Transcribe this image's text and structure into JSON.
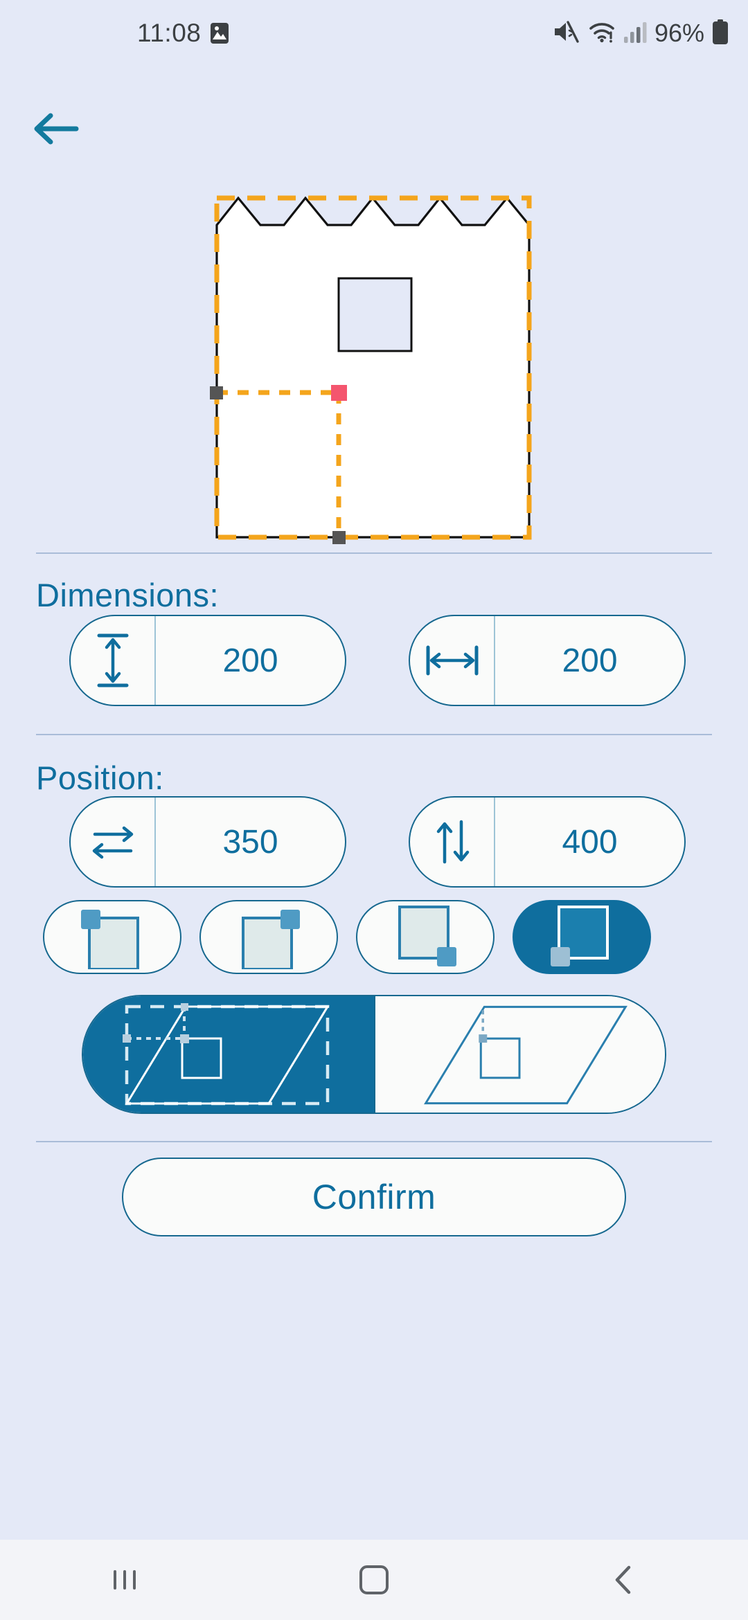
{
  "status_bar": {
    "time": "11:08",
    "battery_percent": "96%",
    "icons": [
      "gallery-image-icon",
      "mute-icon",
      "wifi-warning-icon",
      "signal-bars-icon",
      "battery-icon"
    ]
  },
  "header": {
    "back_label": "Back"
  },
  "preview": {
    "shape_name": "sawtooth-polygon",
    "bounding_box_color": "#f4a51c",
    "shape_stroke_color": "#111111",
    "shape_fill_color": "#ffffff",
    "inner_rect_fill": "#e4e9f7",
    "anchor_marker_color": "#f4556e",
    "handle_color": "#555555",
    "guide_color": "#f4a51c"
  },
  "dimensions": {
    "title": "Dimensions:",
    "height_field": {
      "icon": "height-arrow-icon",
      "value": "200"
    },
    "width_field": {
      "icon": "width-arrow-icon",
      "value": "200"
    }
  },
  "position": {
    "title": "Position:",
    "x_field": {
      "icon": "horizontal-arrows-icon",
      "value": "350"
    },
    "y_field": {
      "icon": "vertical-arrows-icon",
      "value": "400"
    },
    "anchor_options": [
      {
        "name": "anchor-top-left",
        "selected": false
      },
      {
        "name": "anchor-top-right",
        "selected": false
      },
      {
        "name": "anchor-bottom-right",
        "selected": false
      },
      {
        "name": "anchor-bottom-left",
        "selected": true
      }
    ],
    "mode_options": [
      {
        "name": "bounding-box-mode",
        "selected": true
      },
      {
        "name": "shape-only-mode",
        "selected": false
      }
    ]
  },
  "actions": {
    "confirm_label": "Confirm"
  },
  "nav_bar": {
    "recents_label": "Recents",
    "home_label": "Home",
    "back_label": "Back"
  },
  "colors": {
    "background": "#e4e9f7",
    "accent": "#0f6e9e",
    "accent_dark": "#16688f",
    "field_bg": "#fafbfa",
    "divider": "#a9bcd8"
  }
}
